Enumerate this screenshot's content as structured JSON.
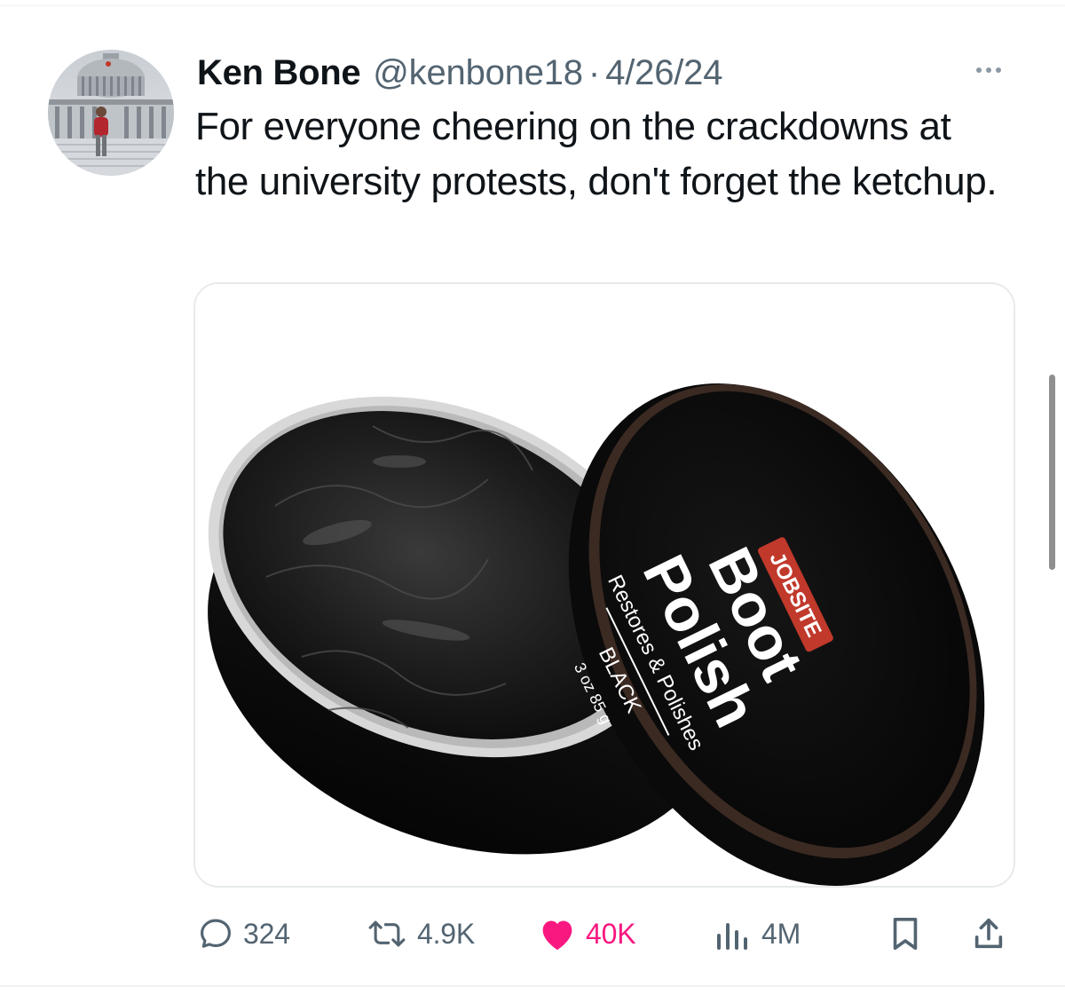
{
  "tweet": {
    "author_name": "Ken Bone",
    "handle": "@kenbone18",
    "separator": "·",
    "date": "4/26/24",
    "text": "For everyone cheering on the crackdowns at the university protests, don't forget the ketchup."
  },
  "media": {
    "brand": "JOBSITE",
    "product_line1": "Boot",
    "product_line2": "Polish",
    "tagline": "Restores & Polishes",
    "color_name": "BLACK",
    "weight": "3 oz 85 g"
  },
  "actions": {
    "replies": "324",
    "reposts": "4.9K",
    "likes": "40K",
    "views": "4M"
  },
  "colors": {
    "text_primary": "#0f1419",
    "text_secondary": "#536471",
    "like_pink": "#f91880",
    "divider": "#eff3f4"
  },
  "icons": [
    "reply-icon",
    "repost-icon",
    "like-icon",
    "views-icon",
    "bookmark-icon",
    "share-icon",
    "more-icon"
  ]
}
